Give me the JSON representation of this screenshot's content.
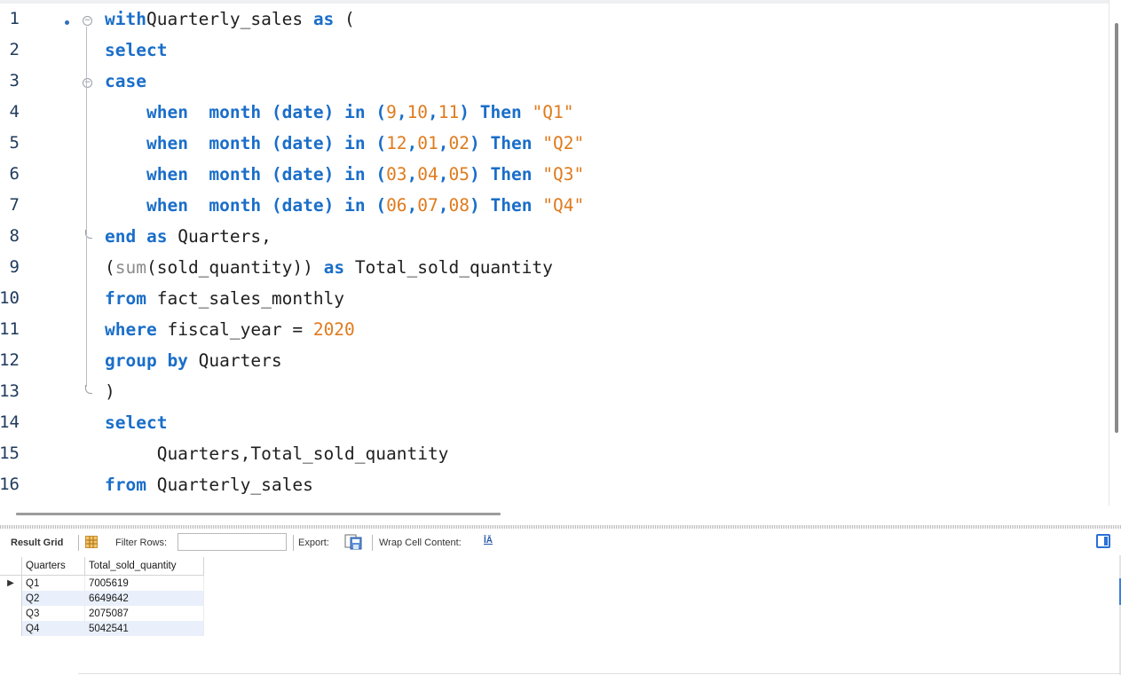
{
  "editor": {
    "lines": [
      {
        "n": "1",
        "tokens": [
          [
            "kw",
            "with"
          ],
          [
            "",
            "Quarterly_sales "
          ],
          [
            "kw",
            "as"
          ],
          [
            "",
            ""
          ],
          [
            "",
            "("
          ]
        ]
      },
      {
        "n": "2",
        "tokens": [
          [
            "kw",
            "select"
          ]
        ]
      },
      {
        "n": "3",
        "tokens": [
          [
            "kw",
            "case"
          ]
        ]
      },
      {
        "n": "4",
        "tokens": [
          [
            "",
            "    "
          ],
          [
            "kw",
            "when"
          ],
          [
            "",
            "  "
          ],
          [
            "kw",
            "month"
          ],
          [
            "",
            ""
          ],
          [
            "kw",
            "(date)"
          ],
          [
            "",
            ""
          ],
          [
            "kw",
            "in"
          ],
          [
            "",
            ""
          ],
          [
            "kw",
            "("
          ],
          [
            "num",
            "9"
          ],
          [
            "kw",
            ","
          ],
          [
            "num",
            "10"
          ],
          [
            "kw",
            ","
          ],
          [
            "num",
            "11"
          ],
          [
            "kw",
            ")"
          ],
          [
            "",
            ""
          ],
          [
            "kw",
            "Then"
          ],
          [
            "",
            ""
          ],
          [
            "str",
            "\"Q1\""
          ]
        ]
      },
      {
        "n": "5",
        "tokens": [
          [
            "",
            "    "
          ],
          [
            "kw",
            "when"
          ],
          [
            "",
            "  "
          ],
          [
            "kw",
            "month"
          ],
          [
            "",
            ""
          ],
          [
            "kw",
            "(date)"
          ],
          [
            "",
            ""
          ],
          [
            "kw",
            "in"
          ],
          [
            "",
            ""
          ],
          [
            "kw",
            "("
          ],
          [
            "num",
            "12"
          ],
          [
            "kw",
            ","
          ],
          [
            "num",
            "01"
          ],
          [
            "kw",
            ","
          ],
          [
            "num",
            "02"
          ],
          [
            "kw",
            ")"
          ],
          [
            "",
            ""
          ],
          [
            "kw",
            "Then"
          ],
          [
            "",
            ""
          ],
          [
            "str",
            "\"Q2\""
          ]
        ]
      },
      {
        "n": "6",
        "tokens": [
          [
            "",
            "    "
          ],
          [
            "kw",
            "when"
          ],
          [
            "",
            "  "
          ],
          [
            "kw",
            "month"
          ],
          [
            "",
            ""
          ],
          [
            "kw",
            "(date)"
          ],
          [
            "",
            ""
          ],
          [
            "kw",
            "in"
          ],
          [
            "",
            ""
          ],
          [
            "kw",
            "("
          ],
          [
            "num",
            "03"
          ],
          [
            "kw",
            ","
          ],
          [
            "num",
            "04"
          ],
          [
            "kw",
            ","
          ],
          [
            "num",
            "05"
          ],
          [
            "kw",
            ")"
          ],
          [
            "",
            ""
          ],
          [
            "kw",
            "Then"
          ],
          [
            "",
            ""
          ],
          [
            "str",
            "\"Q3\""
          ]
        ]
      },
      {
        "n": "7",
        "tokens": [
          [
            "",
            "    "
          ],
          [
            "kw",
            "when"
          ],
          [
            "",
            "  "
          ],
          [
            "kw",
            "month"
          ],
          [
            "",
            ""
          ],
          [
            "kw",
            "(date)"
          ],
          [
            "",
            ""
          ],
          [
            "kw",
            "in"
          ],
          [
            "",
            ""
          ],
          [
            "kw",
            "("
          ],
          [
            "num",
            "06"
          ],
          [
            "kw",
            ","
          ],
          [
            "num",
            "07"
          ],
          [
            "kw",
            ","
          ],
          [
            "num",
            "08"
          ],
          [
            "kw",
            ")"
          ],
          [
            "",
            ""
          ],
          [
            "kw",
            "Then"
          ],
          [
            "",
            ""
          ],
          [
            "str",
            "\"Q4\""
          ]
        ]
      },
      {
        "n": "8",
        "tokens": [
          [
            "kw",
            "end"
          ],
          [
            "",
            ""
          ],
          [
            "kw",
            "as"
          ],
          [
            "",
            ""
          ],
          [
            "",
            "Quarters,"
          ]
        ]
      },
      {
        "n": "9",
        "tokens": [
          [
            "",
            "("
          ],
          [
            "fn",
            "sum"
          ],
          [
            "",
            "(sold_quantity)) "
          ],
          [
            "kw",
            "as"
          ],
          [
            "",
            ""
          ],
          [
            "",
            "Total_sold_quantity"
          ]
        ]
      },
      {
        "n": "10",
        "tokens": [
          [
            "kw",
            "from"
          ],
          [
            "",
            ""
          ],
          [
            "",
            "fact_sales_monthly"
          ]
        ]
      },
      {
        "n": "11",
        "tokens": [
          [
            "kw",
            "where"
          ],
          [
            "",
            ""
          ],
          [
            "",
            "fiscal_year = "
          ],
          [
            "num",
            "2020"
          ]
        ]
      },
      {
        "n": "12",
        "tokens": [
          [
            "kw",
            "group by"
          ],
          [
            "",
            ""
          ],
          [
            "",
            "Quarters"
          ]
        ]
      },
      {
        "n": "13",
        "tokens": [
          [
            "",
            ")"
          ]
        ]
      },
      {
        "n": "14",
        "tokens": [
          [
            "kw",
            "select"
          ]
        ]
      },
      {
        "n": "15",
        "tokens": [
          [
            "",
            "     Quarters,Total_sold_quantity"
          ]
        ]
      },
      {
        "n": "16",
        "tokens": [
          [
            "kw",
            "from"
          ],
          [
            "",
            ""
          ],
          [
            "",
            "Quarterly_sales"
          ]
        ]
      }
    ]
  },
  "toolbar": {
    "result_grid_label": "Result Grid",
    "filter_rows_label": "Filter Rows:",
    "filter_value": "",
    "export_label": "Export:",
    "wrap_label": "Wrap Cell Content:",
    "wrap_icon_glyph": "ĪĀ"
  },
  "grid": {
    "columns": [
      "Quarters",
      "Total_sold_quantity"
    ],
    "rows": [
      [
        "Q1",
        "7005619"
      ],
      [
        "Q2",
        "6649642"
      ],
      [
        "Q3",
        "2075087"
      ],
      [
        "Q4",
        "5042541"
      ]
    ],
    "current_row_marker": "▶"
  },
  "colors": {
    "keyword": "#1a6ec9",
    "number": "#e07b1d",
    "function": "#8c8c8c",
    "row_alt": "#e9f0fb"
  }
}
